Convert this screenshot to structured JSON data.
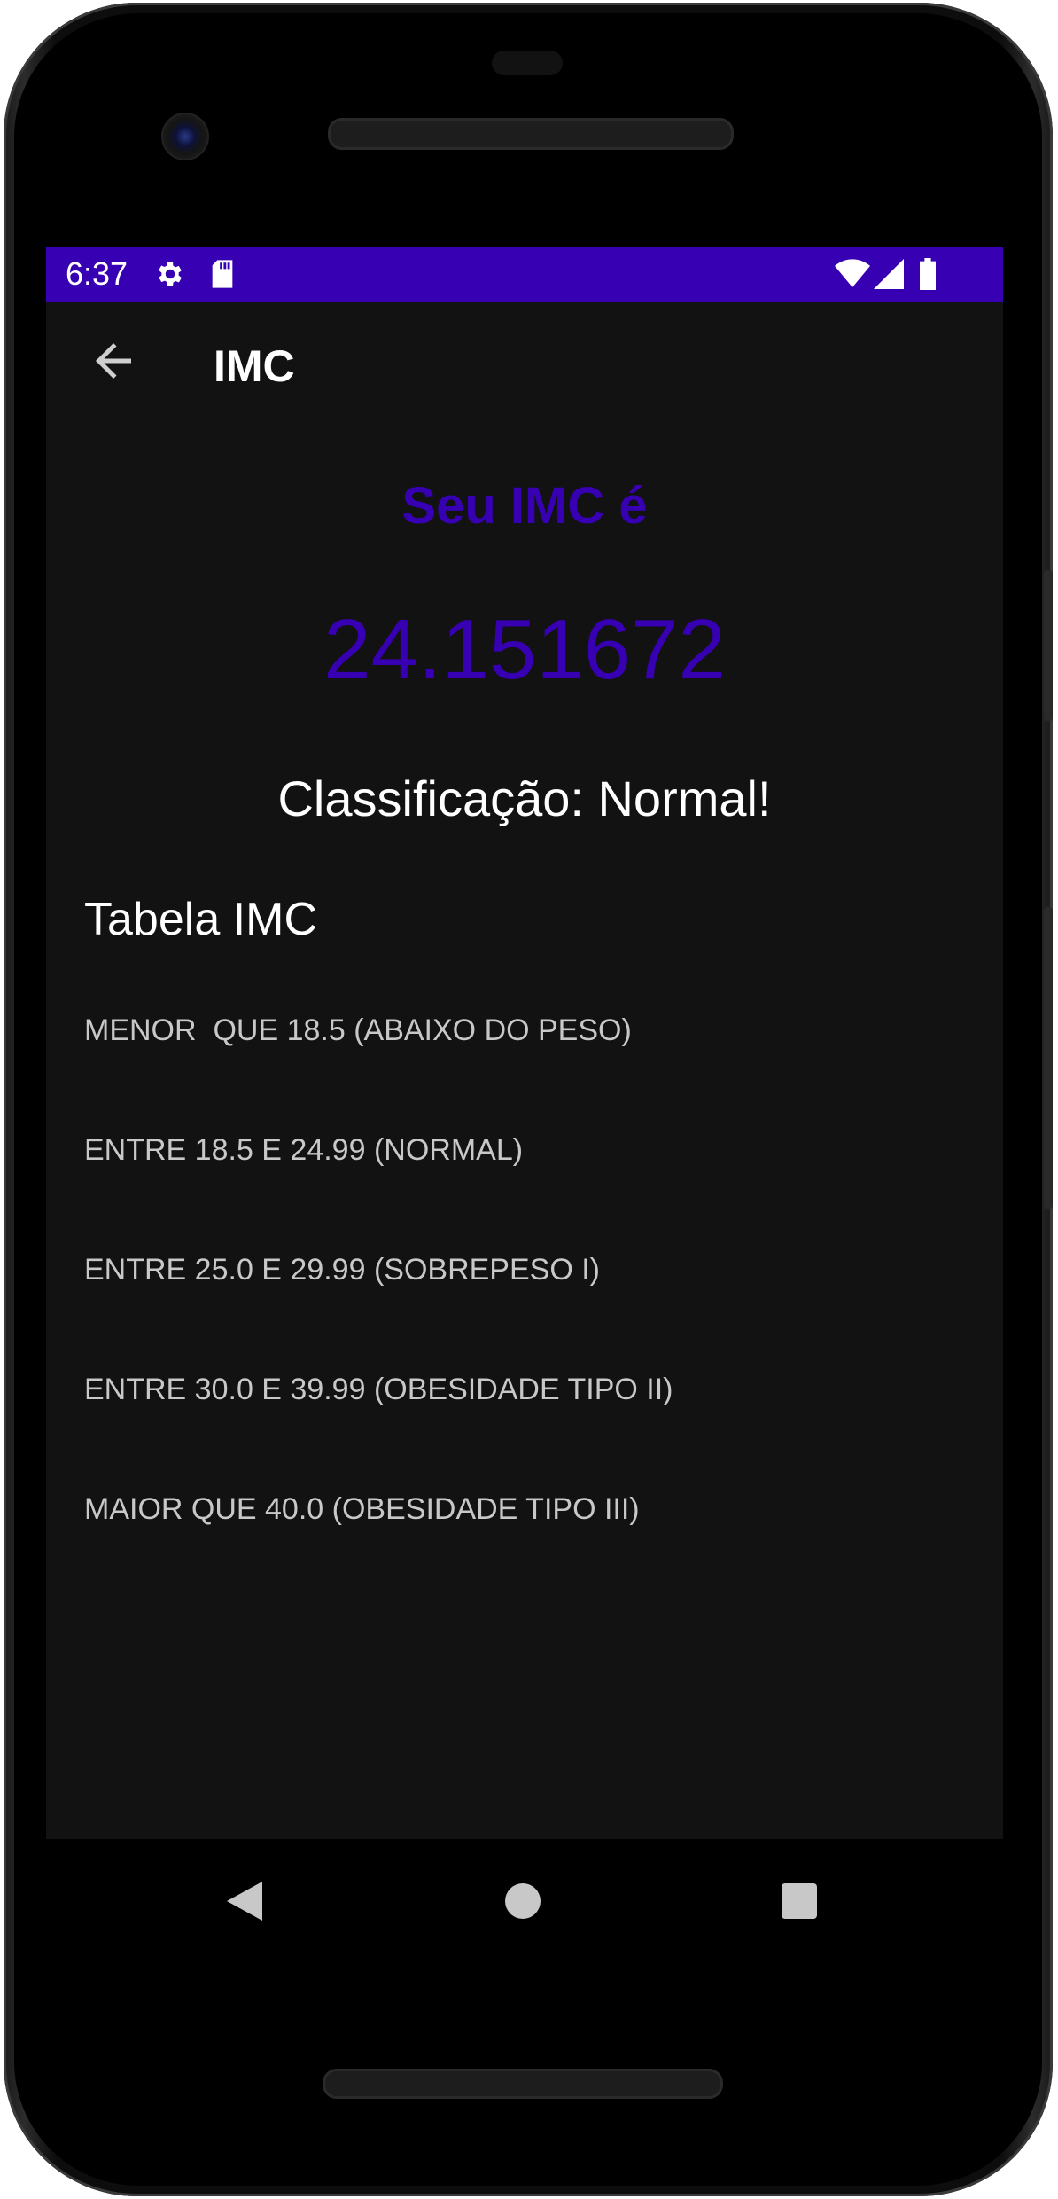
{
  "status_bar": {
    "time": "6:37",
    "icons": [
      "gear-icon",
      "sd-card-icon",
      "wifi-icon",
      "signal-icon",
      "battery-icon"
    ],
    "background": "#3700b3"
  },
  "app_bar": {
    "title": "IMC",
    "back_icon": "arrow-back-icon"
  },
  "result": {
    "heading": "Seu IMC é",
    "value": "24.151672",
    "classification": "Classificação: Normal!",
    "accent_color": "#3700b3"
  },
  "table": {
    "title": "Tabela IMC",
    "rows": [
      "MENOR  QUE 18.5 (ABAIXO DO PESO)",
      "ENTRE 18.5 E 24.99 (NORMAL)",
      "ENTRE 25.0 E 29.99 (SOBREPESO I)",
      "ENTRE 30.0 E 39.99 (OBESIDADE TIPO II)",
      "MAIOR QUE 40.0 (OBESIDADE TIPO III)"
    ]
  },
  "nav_bar": {
    "buttons": [
      "back-triangle-icon",
      "home-circle-icon",
      "recents-square-icon"
    ]
  }
}
